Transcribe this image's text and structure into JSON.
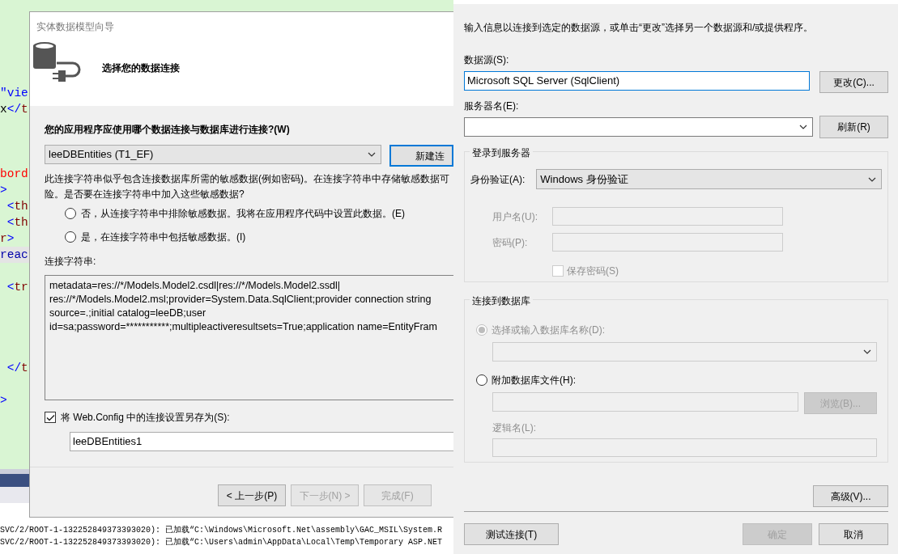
{
  "editor": {
    "lines": [
      {
        "kind": "code",
        "current": false,
        "segments": [
          {
            "kind": "string",
            "text": "\"vie"
          }
        ]
      },
      {
        "kind": "code",
        "current": false,
        "segments": [
          {
            "kind": "text",
            "text": "x"
          },
          {
            "kind": "punct",
            "text": "</"
          },
          {
            "kind": "tag",
            "text": "t"
          }
        ]
      },
      {
        "kind": "blank"
      },
      {
        "kind": "blank"
      },
      {
        "kind": "blank"
      },
      {
        "kind": "code",
        "current": false,
        "segments": [
          {
            "kind": "attr",
            "text": "bord"
          }
        ]
      },
      {
        "kind": "code",
        "current": false,
        "segments": [
          {
            "kind": "punct",
            "text": ">"
          }
        ]
      },
      {
        "kind": "code",
        "current": false,
        "segments": [
          {
            "kind": "punct",
            "text": " <"
          },
          {
            "kind": "tag",
            "text": "th"
          }
        ]
      },
      {
        "kind": "code",
        "current": false,
        "segments": [
          {
            "kind": "punct",
            "text": " <"
          },
          {
            "kind": "tag",
            "text": "th"
          }
        ]
      },
      {
        "kind": "code",
        "current": false,
        "segments": [
          {
            "kind": "tag",
            "text": "r"
          },
          {
            "kind": "punct",
            "text": ">"
          }
        ]
      },
      {
        "kind": "code",
        "current": true,
        "segments": [
          {
            "kind": "keyword",
            "text": "reac"
          }
        ]
      },
      {
        "kind": "blank"
      },
      {
        "kind": "code",
        "current": false,
        "segments": [
          {
            "kind": "punct",
            "text": " <"
          },
          {
            "kind": "tag",
            "text": "tr"
          }
        ]
      },
      {
        "kind": "blank"
      },
      {
        "kind": "blank"
      },
      {
        "kind": "blank"
      },
      {
        "kind": "blank"
      },
      {
        "kind": "code",
        "current": false,
        "segments": [
          {
            "kind": "punct",
            "text": " </"
          },
          {
            "kind": "tag",
            "text": "t"
          }
        ]
      },
      {
        "kind": "blank"
      },
      {
        "kind": "code",
        "current": false,
        "segments": [
          {
            "kind": "punct",
            "text": ">"
          }
        ]
      }
    ]
  },
  "output": {
    "lines": [
      "SVC/2/ROOT-1-132252849373393020): 已加载“C:\\Windows\\Microsoft.Net\\assembly\\GAC_MSIL\\System.R",
      "SVC/2/ROOT-1-132252849373393020): 已加载“C:\\Users\\admin\\AppData\\Local\\Temp\\Temporary ASP.NET"
    ]
  },
  "wizard": {
    "title": "实体数据模型向导",
    "heading": "选择您的数据连接",
    "question": "您的应用程序应使用哪个数据连接与数据库进行连接?(W)",
    "connection": "leeDBEntities (T1_EF)",
    "new_button": "新建连",
    "warning_lines": [
      "此连接字符串似乎包含连接数据库所需的敏感数据(例如密码)。在连接字符串中存储敏感数据可",
      "险。是否要在连接字符串中加入这些敏感数据?"
    ],
    "options": [
      {
        "label": "否，从连接字符串中排除敏感数据。我将在应用程序代码中设置此数据。(E)",
        "selected": false
      },
      {
        "label": "是，在连接字符串中包括敏感数据。(I)",
        "selected": false
      }
    ],
    "conn_label": "连接字符串:",
    "conn_lines": [
      "metadata=res://*/Models.Model2.csdl|res://*/Models.Model2.ssdl|",
      "res://*/Models.Model2.msl;provider=System.Data.SqlClient;provider connection string",
      "source=.;initial catalog=leeDB;user",
      "id=sa;password=***********;multipleactiveresultsets=True;application name=EntityFram"
    ],
    "save": {
      "label": "将 Web.Config 中的连接设置另存为(S):",
      "checked": true
    },
    "save_name": "leeDBEntities1",
    "buttons": [
      {
        "label": "< 上一步(P)",
        "disabled": false
      },
      {
        "label": "下一步(N) >",
        "disabled": true
      },
      {
        "label": "完成(F)",
        "disabled": true
      }
    ]
  },
  "dialog": {
    "hint": "输入信息以连接到选定的数据源，或单击“更改”选择另一个数据源和/或提供程序。",
    "source_label": "数据源(S):",
    "source_value": "Microsoft SQL Server (SqlClient)",
    "change_button": "更改(C)...",
    "server_label": "服务器名(E):",
    "refresh_button": "刷新(R)",
    "login": {
      "title": "登录到服务器",
      "auth_label": "身份验证(A):",
      "auth_value": "Windows 身份验证",
      "credentials_disabled": true,
      "user_label": "用户名(U):",
      "password_label": "密码(P):",
      "save_password": {
        "label": "保存密码(S)",
        "checked": false
      }
    },
    "database": {
      "title": "连接到数据库",
      "options": [
        {
          "label": "选择或输入数据库名称(D):",
          "selected": true,
          "disabled": true
        },
        {
          "label": "附加数据库文件(H):",
          "selected": false,
          "disabled": false
        }
      ],
      "browse": {
        "label": "浏览(B)...",
        "disabled": true
      },
      "logical_label": "逻辑名(L):"
    },
    "advanced_button": "高级(V)...",
    "buttons": [
      {
        "label": "测试连接(T)",
        "disabled": false
      },
      {
        "label": "确定",
        "disabled": true
      },
      {
        "label": "取消",
        "disabled": false
      }
    ]
  }
}
